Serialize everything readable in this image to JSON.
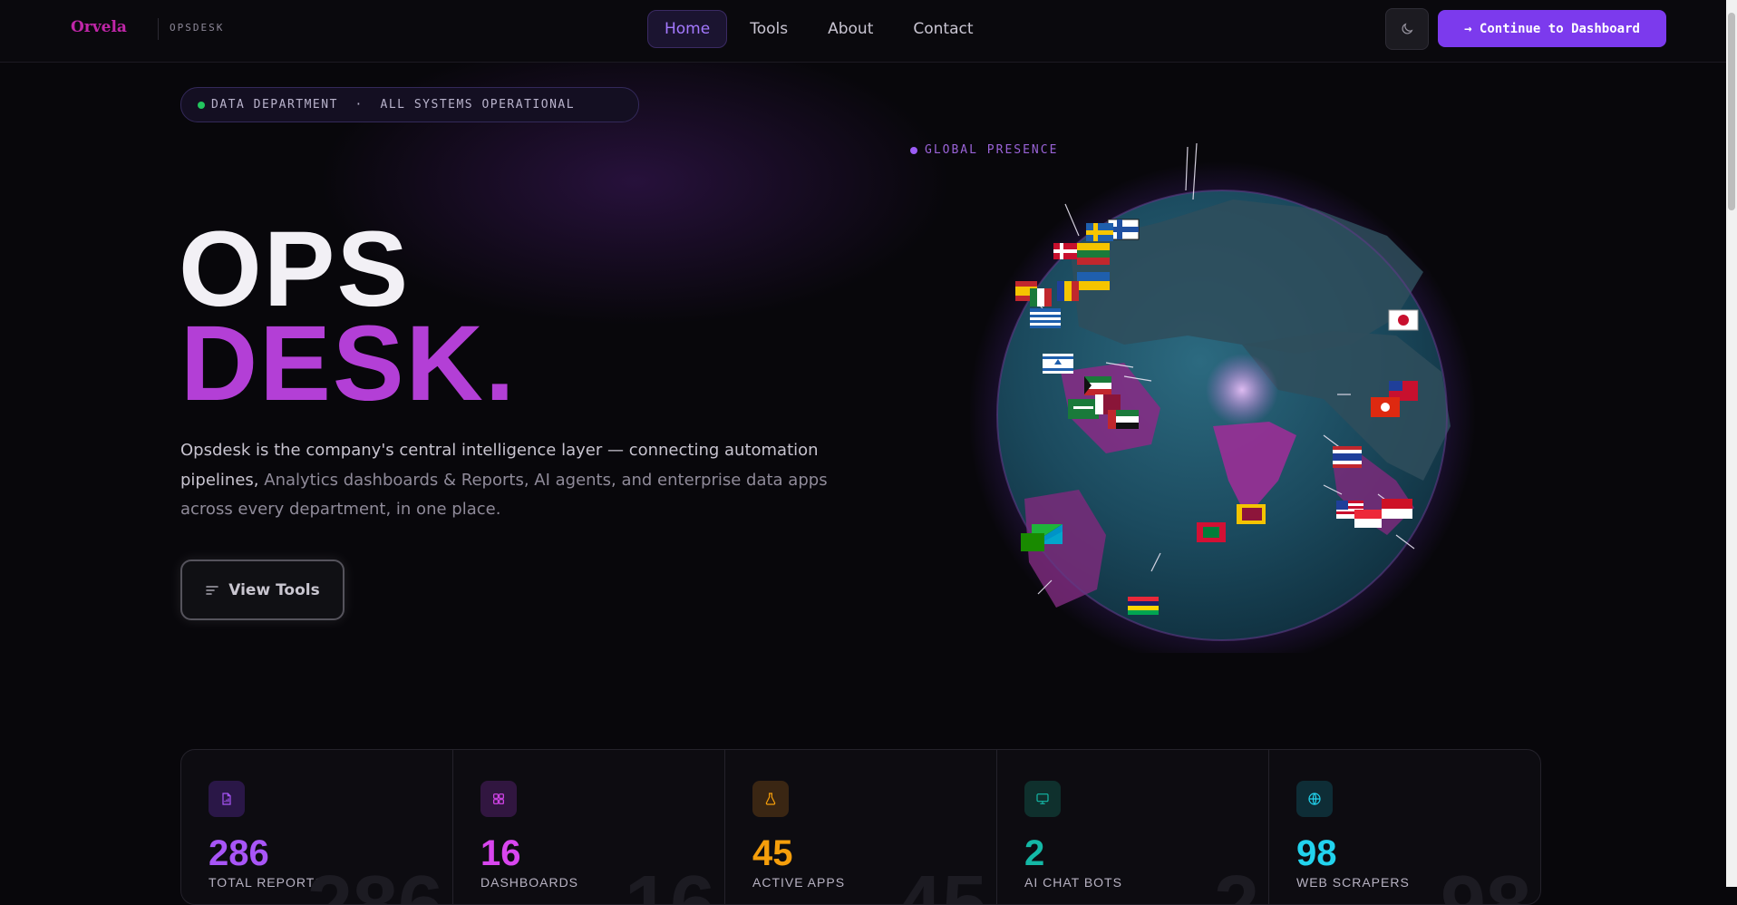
{
  "brand": {
    "name": "Orvela",
    "product": "OPSDESK"
  },
  "nav": {
    "links": [
      {
        "label": "Home",
        "active": true
      },
      {
        "label": "Tools",
        "active": false
      },
      {
        "label": "About",
        "active": false
      },
      {
        "label": "Contact",
        "active": false
      }
    ],
    "theme_icon": "moon-icon",
    "cta_label": "→ Continue to Dashboard"
  },
  "status": {
    "text": "DATA DEPARTMENT  ·  ALL SYSTEMS OPERATIONAL",
    "dot_color": "#22c55e"
  },
  "hero": {
    "title_line1": "OPS",
    "title_line2": "DESK.",
    "description_main": "Opsdesk is the company's central intelligence layer — connecting automation pipelines,",
    "description_rest": "Analytics dashboards & Reports, AI agents, and enterprise data apps across every department, in one place.",
    "button_label": "View Tools",
    "accent_color": "#b33fd6"
  },
  "globe": {
    "label": "GLOBAL PRESENCE"
  },
  "stats": [
    {
      "value": "286",
      "label": "TOTAL REPORTS",
      "color": "#a855f7",
      "icon": "report-icon"
    },
    {
      "value": "16",
      "label": "DASHBOARDS",
      "color": "#d946ef",
      "icon": "grid-icon"
    },
    {
      "value": "45",
      "label": "ACTIVE APPS",
      "color": "#f59e0b",
      "icon": "flask-icon"
    },
    {
      "value": "2",
      "label": "AI CHAT BOTS",
      "color": "#14b8a6",
      "icon": "monitor-icon"
    },
    {
      "value": "98",
      "label": "WEB SCRAPERS",
      "color": "#22d3ee",
      "icon": "globe-icon"
    }
  ]
}
